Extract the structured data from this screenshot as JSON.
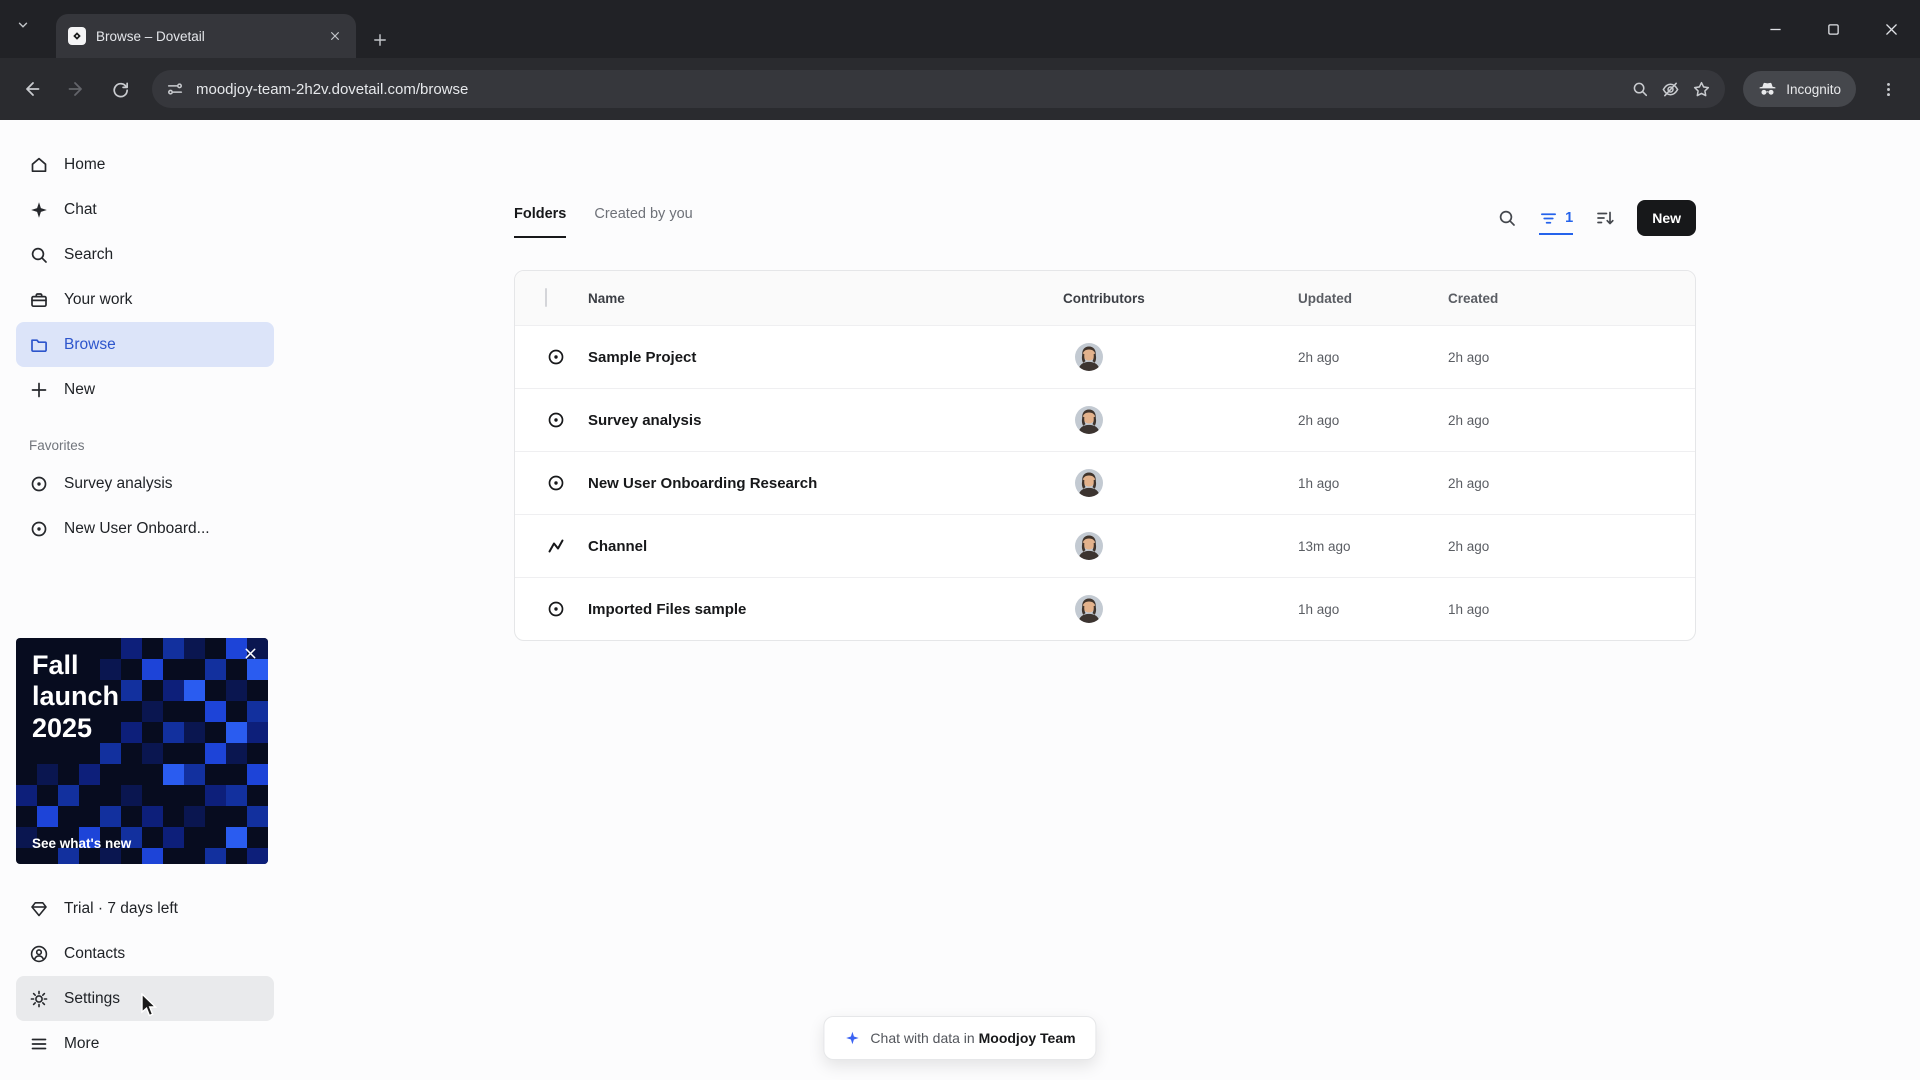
{
  "browser": {
    "tab_title": "Browse – Dovetail",
    "url": "moodjoy-team-2h2v.dovetail.com/browse",
    "incognito_label": "Incognito"
  },
  "sidebar": {
    "items": [
      {
        "label": "Home"
      },
      {
        "label": "Chat"
      },
      {
        "label": "Search"
      },
      {
        "label": "Your work"
      },
      {
        "label": "Browse"
      },
      {
        "label": "New"
      }
    ],
    "favorites_header": "Favorites",
    "favorites": [
      {
        "label": "Survey analysis"
      },
      {
        "label": "New User Onboard..."
      }
    ],
    "promo": {
      "title": "Fall launch 2025",
      "cta": "See what's new"
    },
    "footer": [
      {
        "label": "Trial · 7 days left"
      },
      {
        "label": "Contacts"
      },
      {
        "label": "Settings"
      },
      {
        "label": "More"
      }
    ]
  },
  "main": {
    "tabs": [
      {
        "label": "Folders"
      },
      {
        "label": "Created by you"
      }
    ],
    "filter_count": "1",
    "new_button": "New",
    "table": {
      "columns": [
        "Name",
        "Contributors",
        "Updated",
        "Created"
      ],
      "rows": [
        {
          "name": "Sample Project",
          "updated": "2h ago",
          "created": "2h ago"
        },
        {
          "name": "Survey analysis",
          "updated": "2h ago",
          "created": "2h ago"
        },
        {
          "name": "New User Onboarding Research",
          "updated": "1h ago",
          "created": "2h ago"
        },
        {
          "name": "Channel",
          "updated": "13m ago",
          "created": "2h ago"
        },
        {
          "name": "Imported Files sample",
          "updated": "1h ago",
          "created": "1h ago"
        }
      ]
    },
    "chat_pill": {
      "prefix": "Chat with data in",
      "team": "Moodjoy Team"
    }
  },
  "colors": {
    "accent": "#2d55cc",
    "filter_blue": "#2563eb",
    "new_button_bg": "#17181a",
    "promo_bg": "#070c1f"
  }
}
